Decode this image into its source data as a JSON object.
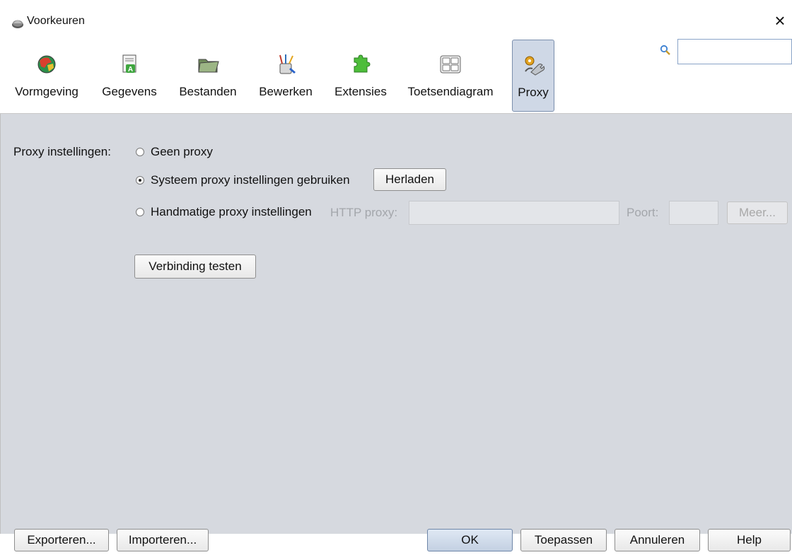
{
  "window": {
    "title": "Voorkeuren"
  },
  "toolbar": {
    "items": [
      {
        "label": "Vormgeving"
      },
      {
        "label": "Gegevens"
      },
      {
        "label": "Bestanden"
      },
      {
        "label": "Bewerken"
      },
      {
        "label": "Extensies"
      },
      {
        "label": "Toetsendiagram"
      },
      {
        "label": "Proxy"
      }
    ],
    "selected": "Proxy",
    "search": {
      "value": "",
      "placeholder": ""
    }
  },
  "proxy": {
    "section_label": "Proxy instellingen:",
    "option_none": {
      "label": "Geen proxy",
      "checked": false
    },
    "option_system": {
      "label": "Systeem proxy instellingen gebruiken",
      "checked": true
    },
    "reload_label": "Herladen",
    "option_manual": {
      "label": "Handmatige proxy instellingen",
      "checked": false
    },
    "http_proxy_label": "HTTP proxy:",
    "http_proxy_value": "",
    "port_label": "Poort:",
    "port_value": "",
    "more_label": "Meer...",
    "test_label": "Verbinding testen"
  },
  "footer": {
    "export_label": "Exporteren...",
    "import_label": "Importeren...",
    "ok_label": "OK",
    "apply_label": "Toepassen",
    "cancel_label": "Annuleren",
    "help_label": "Help"
  },
  "colors": {
    "background": "#d6d9df",
    "selected_tab": "#cfd8e6",
    "accent": "#2b78d8"
  }
}
